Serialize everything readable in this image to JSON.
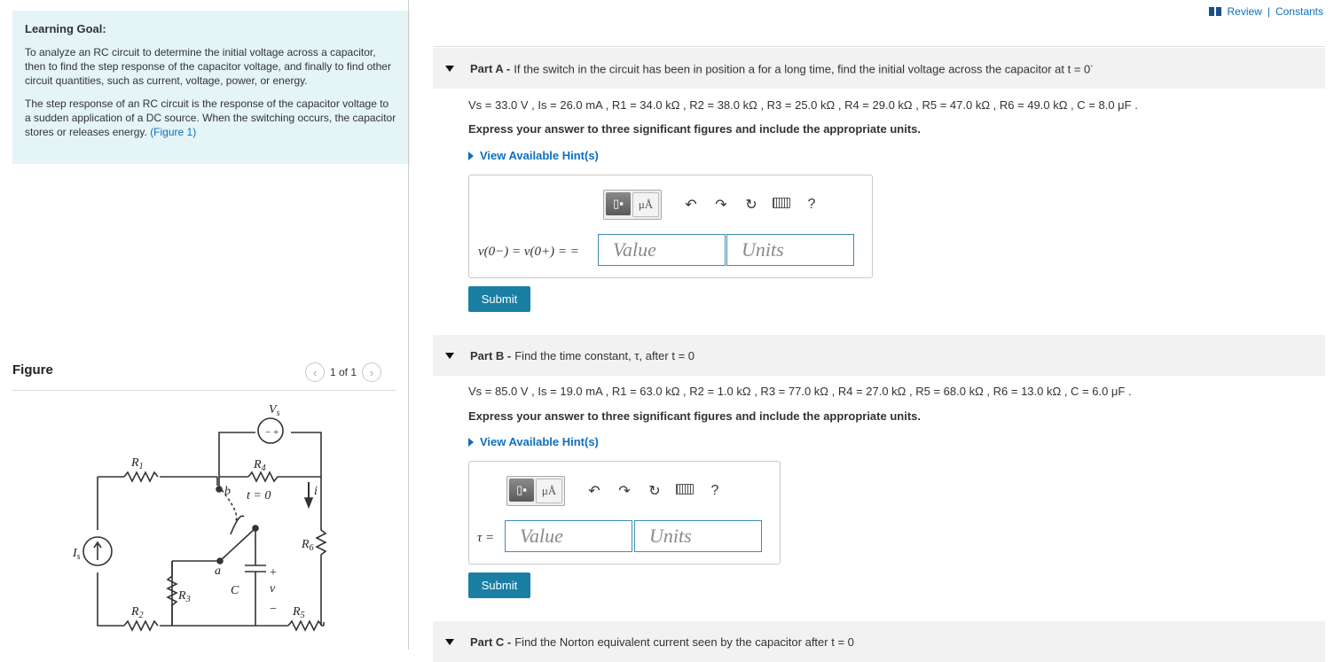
{
  "top_links": {
    "review": "Review",
    "separator": "|",
    "constants": "Constants"
  },
  "learning_goal": {
    "title": "Learning Goal:",
    "p1": "To analyze an RC circuit to determine the initial voltage across a capacitor, then to find the step response of the capacitor voltage, and finally to find other circuit quantities, such as current, voltage, power, or energy.",
    "p2_text": "The step response of an RC circuit is the response of the capacitor voltage to a sudden application of a DC source. When the switching occurs, the capacitor stores or releases energy.",
    "p2_link": "(Figure 1)"
  },
  "figure": {
    "title": "Figure",
    "pager": "1 of 1",
    "labels": {
      "vs": "V",
      "vs_sub": "s",
      "r1": "R",
      "r1_sub": "1",
      "r4": "R",
      "r4_sub": "4",
      "b": "b",
      "t0": "t = 0",
      "i": "i",
      "is": "I",
      "is_sub": "s",
      "r6": "R",
      "r6_sub": "6",
      "a": "a",
      "plus": "+",
      "c": "C",
      "v": "v",
      "r3": "R",
      "r3_sub": "3",
      "minus": "−",
      "r2": "R",
      "r2_sub": "2",
      "r5": "R",
      "r5_sub": "5"
    }
  },
  "parts": [
    {
      "label": "Part A -",
      "question": "If the switch in the circuit has been in position a for a long time, find the initial voltage across the capacitor at t = 0",
      "q_super": "-",
      "givens": "Vs = 33.0 V , Is = 26.0 mA , R1 = 34.0 kΩ , R2 = 38.0 kΩ , R3 = 25.0 kΩ , R4 = 29.0 kΩ , R5 = 47.0 kΩ , R6 = 49.0 kΩ , C = 8.0 μF .",
      "instruction": "Express your answer to three significant figures and include the appropriate units.",
      "hint": "View Available Hint(s)",
      "answer_label": "v(0−) = v(0+) = =",
      "value_placeholder": "Value",
      "units_placeholder": "Units",
      "submit": "Submit"
    },
    {
      "label": "Part B -",
      "question": "Find the time constant, τ, after t = 0",
      "givens": "Vs = 85.0 V , Is = 19.0 mA , R1 = 63.0 kΩ , R2 = 1.0 kΩ , R3 = 77.0 kΩ , R4 = 27.0 kΩ , R5 = 68.0 kΩ , R6 = 13.0 kΩ , C = 6.0 μF .",
      "instruction": "Express your answer to three significant figures and include the appropriate units.",
      "hint": "View Available Hint(s)",
      "answer_label": "τ =",
      "value_placeholder": "Value",
      "units_placeholder": "Units",
      "submit": "Submit"
    },
    {
      "label": "Part C -",
      "question": "Find the Norton equivalent current seen by the capacitor after t = 0"
    }
  ],
  "toolbar": {
    "units_btn": "μÅ",
    "help": "?"
  },
  "colors": {
    "accent": "#1a7fa3",
    "link": "#0e6fbd",
    "goal_bg": "#e5f4f6"
  }
}
